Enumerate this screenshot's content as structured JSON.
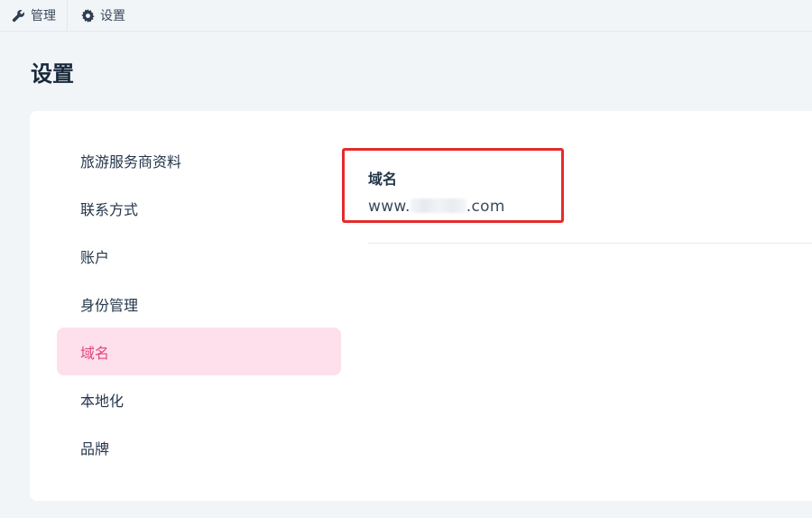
{
  "topnav": {
    "tabs": [
      {
        "label": "管理",
        "icon": "wrench-icon"
      },
      {
        "label": "设置",
        "icon": "gear-icon"
      }
    ]
  },
  "page": {
    "title": "设置"
  },
  "sidebar": {
    "items": [
      {
        "label": "旅游服务商资料"
      },
      {
        "label": "联系方式"
      },
      {
        "label": "账户"
      },
      {
        "label": "身份管理"
      },
      {
        "label": "域名",
        "active": true
      },
      {
        "label": "本地化"
      },
      {
        "label": "品牌"
      }
    ]
  },
  "domain_section": {
    "label": "域名",
    "value_prefix": "www.",
    "value_suffix": ".com"
  },
  "colors": {
    "active_bg": "#fde0ec",
    "active_text": "#e2457e",
    "highlight_border": "#e52b2b"
  }
}
